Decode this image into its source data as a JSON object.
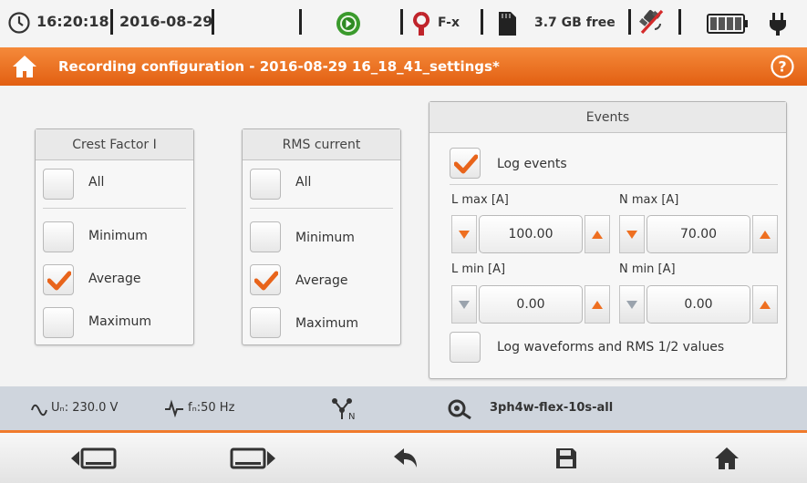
{
  "status_bar": {
    "time": "16:20:18",
    "date": "2016-08-29",
    "clamp_type": "F-x",
    "storage_free": "3.7 GB free"
  },
  "title_bar": {
    "title": "Recording configuration - 2016-08-29 16_18_41_settings*"
  },
  "crest_factor": {
    "title": "Crest Factor I",
    "all": {
      "label": "All",
      "checked": false
    },
    "options": [
      {
        "label": "Minimum",
        "checked": false
      },
      {
        "label": "Average",
        "checked": true
      },
      {
        "label": "Maximum",
        "checked": false
      }
    ]
  },
  "rms_current": {
    "title": "RMS current",
    "all": {
      "label": "All",
      "checked": false
    },
    "options": [
      {
        "label": "Minimum",
        "checked": false
      },
      {
        "label": "Average",
        "checked": true
      },
      {
        "label": "Maximum",
        "checked": false
      }
    ]
  },
  "events": {
    "title": "Events",
    "log_events": {
      "label": "Log events",
      "checked": true
    },
    "l_max": {
      "label": "L max [A]",
      "value": "100.00"
    },
    "n_max": {
      "label": "N max [A]",
      "value": "70.00"
    },
    "l_min": {
      "label": "L min [A]",
      "value": "0.00"
    },
    "n_min": {
      "label": "N min [A]",
      "value": "0.00"
    },
    "log_waveforms": {
      "label": "Log waveforms and RMS 1/2 values",
      "checked": false
    }
  },
  "info_bar": {
    "voltage": "Uₙ: 230.0 V",
    "frequency": "fₙ:50 Hz",
    "config_name": "3ph4w-flex-10s-all"
  },
  "colors": {
    "accent": "#ee6f20",
    "check": "#e8641b",
    "info_bar": "#cfd5dd"
  },
  "icons": [
    "clock-icon",
    "record-play-icon",
    "clamp-icon",
    "sd-card-icon",
    "gps-off-icon",
    "battery-icon",
    "plug-icon",
    "home-icon",
    "help-icon",
    "sine-icon",
    "frequency-icon",
    "wye-network-icon",
    "clamp-config-icon",
    "prev-screen-icon",
    "next-screen-icon",
    "back-icon",
    "save-icon"
  ]
}
